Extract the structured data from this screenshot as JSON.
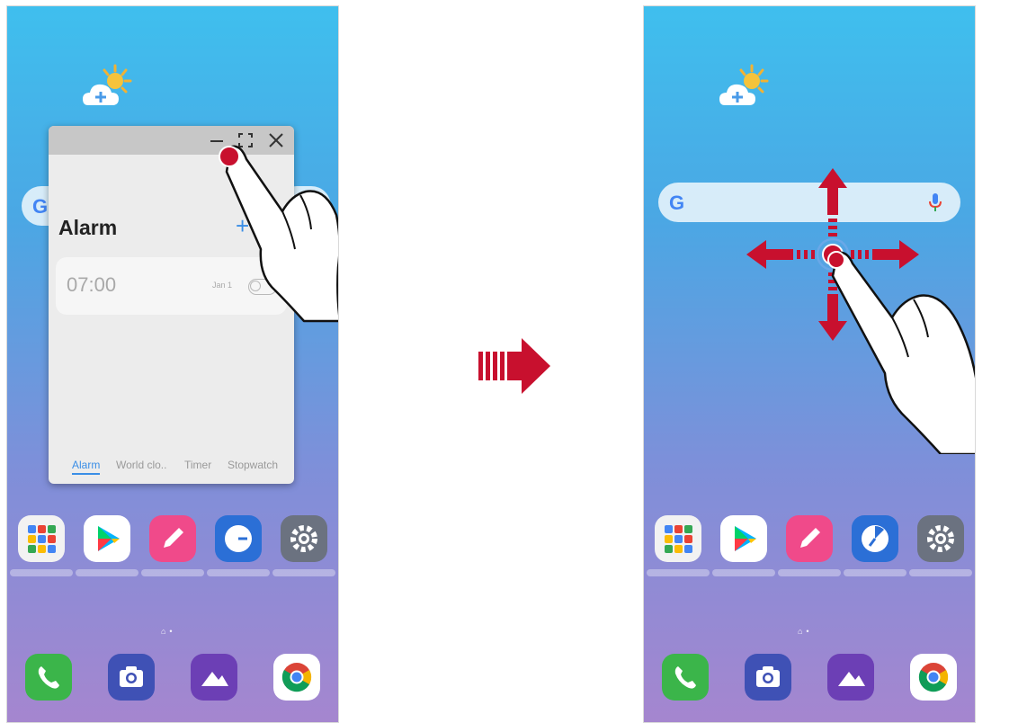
{
  "alarm_popup": {
    "title": "Alarm",
    "plus_icon": "+",
    "alarm_time": "07:00",
    "alarm_days": "Jan 1",
    "tabs": [
      "Alarm",
      "World clo..",
      "Timer",
      "Stopwatch"
    ],
    "controls": {
      "minimize_icon": "minimize-icon",
      "expand_icon": "expand-icon",
      "close_icon": "close-icon"
    }
  },
  "colors": {
    "accent_blue": "#3a8ee6",
    "gesture_red": "#c8102e",
    "phone_gradient_top": "#3fbfee",
    "phone_gradient_bottom": "#a586cf"
  },
  "icons": {
    "weather": "weather-cloud-sun-icon",
    "google": "google-g-icon",
    "mic": "microphone-icon",
    "apps_row": [
      "google-folder-icon",
      "play-store-icon",
      "quickmemo-icon",
      "clock-icon",
      "settings-icon"
    ],
    "dock": [
      "phone-icon",
      "camera-icon",
      "gallery-icon",
      "chrome-icon"
    ],
    "transition": "right-arrow-icon",
    "drag": "four-direction-arrow-icon",
    "hand": "hand-gesture-icon"
  }
}
